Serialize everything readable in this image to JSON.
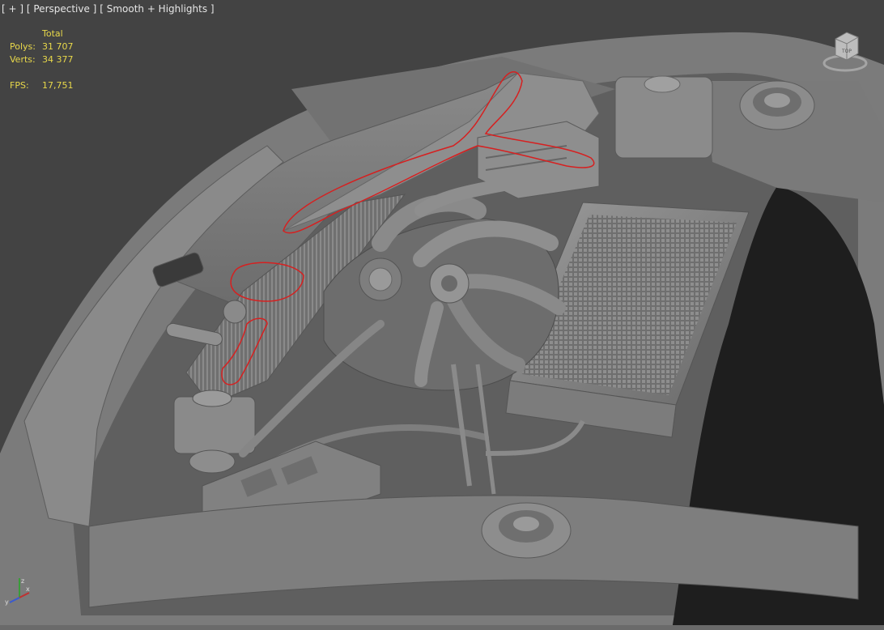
{
  "viewport": {
    "labels": [
      "[ + ]",
      "[ Perspective ]",
      "[ Smooth + Highlights ]"
    ]
  },
  "stats": {
    "header": "Total",
    "polys_label": "Polys:",
    "polys_value": "31 707",
    "verts_label": "Verts:",
    "verts_value": "34 377",
    "fps_label": "FPS:",
    "fps_value": "17,751"
  },
  "viewcube": {
    "face_label": "TOP"
  },
  "axis": {
    "x": "x",
    "y": "y",
    "z": "z"
  },
  "colors": {
    "background": "#434343",
    "stats_text": "#e8d84a",
    "label_text": "#e6e6e6",
    "annotation_stroke": "#d62020",
    "model_base": "#808080"
  }
}
